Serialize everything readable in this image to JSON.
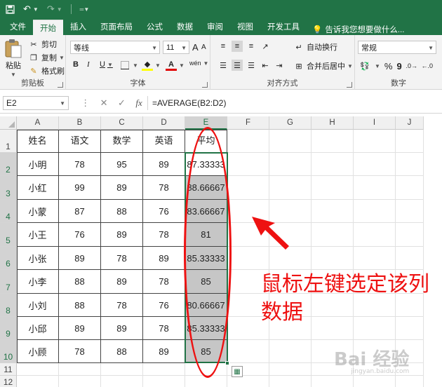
{
  "titlebar": {
    "save_icon": "save-icon",
    "undo_icon": "undo-icon",
    "redo_icon": "redo-icon",
    "customize_icon": "customize-qat-icon"
  },
  "ribbon_tabs": [
    {
      "label": "文件",
      "active": false
    },
    {
      "label": "开始",
      "active": true
    },
    {
      "label": "插入",
      "active": false
    },
    {
      "label": "页面布局",
      "active": false
    },
    {
      "label": "公式",
      "active": false
    },
    {
      "label": "数据",
      "active": false
    },
    {
      "label": "审阅",
      "active": false
    },
    {
      "label": "视图",
      "active": false
    },
    {
      "label": "开发工具",
      "active": false
    }
  ],
  "tell_me": "告诉我您想要做什么...",
  "clipboard": {
    "paste": "粘贴",
    "cut": "剪切",
    "copy": "复制",
    "format_painter": "格式刷",
    "label": "剪贴板"
  },
  "font": {
    "name": "等线",
    "size": "11",
    "bold": "B",
    "italic": "I",
    "underline": "U",
    "font_color": "A",
    "phonetic": "wén",
    "grow": "A",
    "shrink": "A",
    "label": "字体"
  },
  "alignment": {
    "wrap_text": "自动换行",
    "merge_center": "合并后居中",
    "label": "对齐方式"
  },
  "number": {
    "format": "常规",
    "percent": "%",
    "comma": "9",
    "label": "数字"
  },
  "formula_bar": {
    "name_box": "E2",
    "fx": "fx",
    "formula": "=AVERAGE(B2:D2)"
  },
  "columns": [
    "A",
    "B",
    "C",
    "D",
    "E",
    "F",
    "G",
    "H",
    "I",
    "J"
  ],
  "rows": [
    "1",
    "2",
    "3",
    "4",
    "5",
    "6",
    "7",
    "8",
    "9",
    "10",
    "11",
    "12"
  ],
  "table": {
    "headers": [
      "姓名",
      "语文",
      "数学",
      "英语",
      "平均"
    ],
    "rows": [
      [
        "小明",
        "78",
        "95",
        "89",
        "87.33333"
      ],
      [
        "小红",
        "99",
        "89",
        "78",
        "88.66667"
      ],
      [
        "小蒙",
        "87",
        "88",
        "76",
        "83.66667"
      ],
      [
        "小王",
        "76",
        "89",
        "78",
        "81"
      ],
      [
        "小张",
        "89",
        "78",
        "89",
        "85.33333"
      ],
      [
        "小李",
        "88",
        "89",
        "78",
        "85"
      ],
      [
        "小刘",
        "88",
        "78",
        "76",
        "80.66667"
      ],
      [
        "小邱",
        "89",
        "89",
        "78",
        "85.33333"
      ],
      [
        "小顾",
        "78",
        "88",
        "89",
        "85"
      ]
    ]
  },
  "annotation": "鼠标左键选定该列数据",
  "watermark": {
    "brand": "Bai 经验",
    "url": "jingyan.baidu.com"
  },
  "colors": {
    "excel_green": "#217346",
    "annotation_red": "#ee1111",
    "selection_fill": "#c6c6c6"
  }
}
